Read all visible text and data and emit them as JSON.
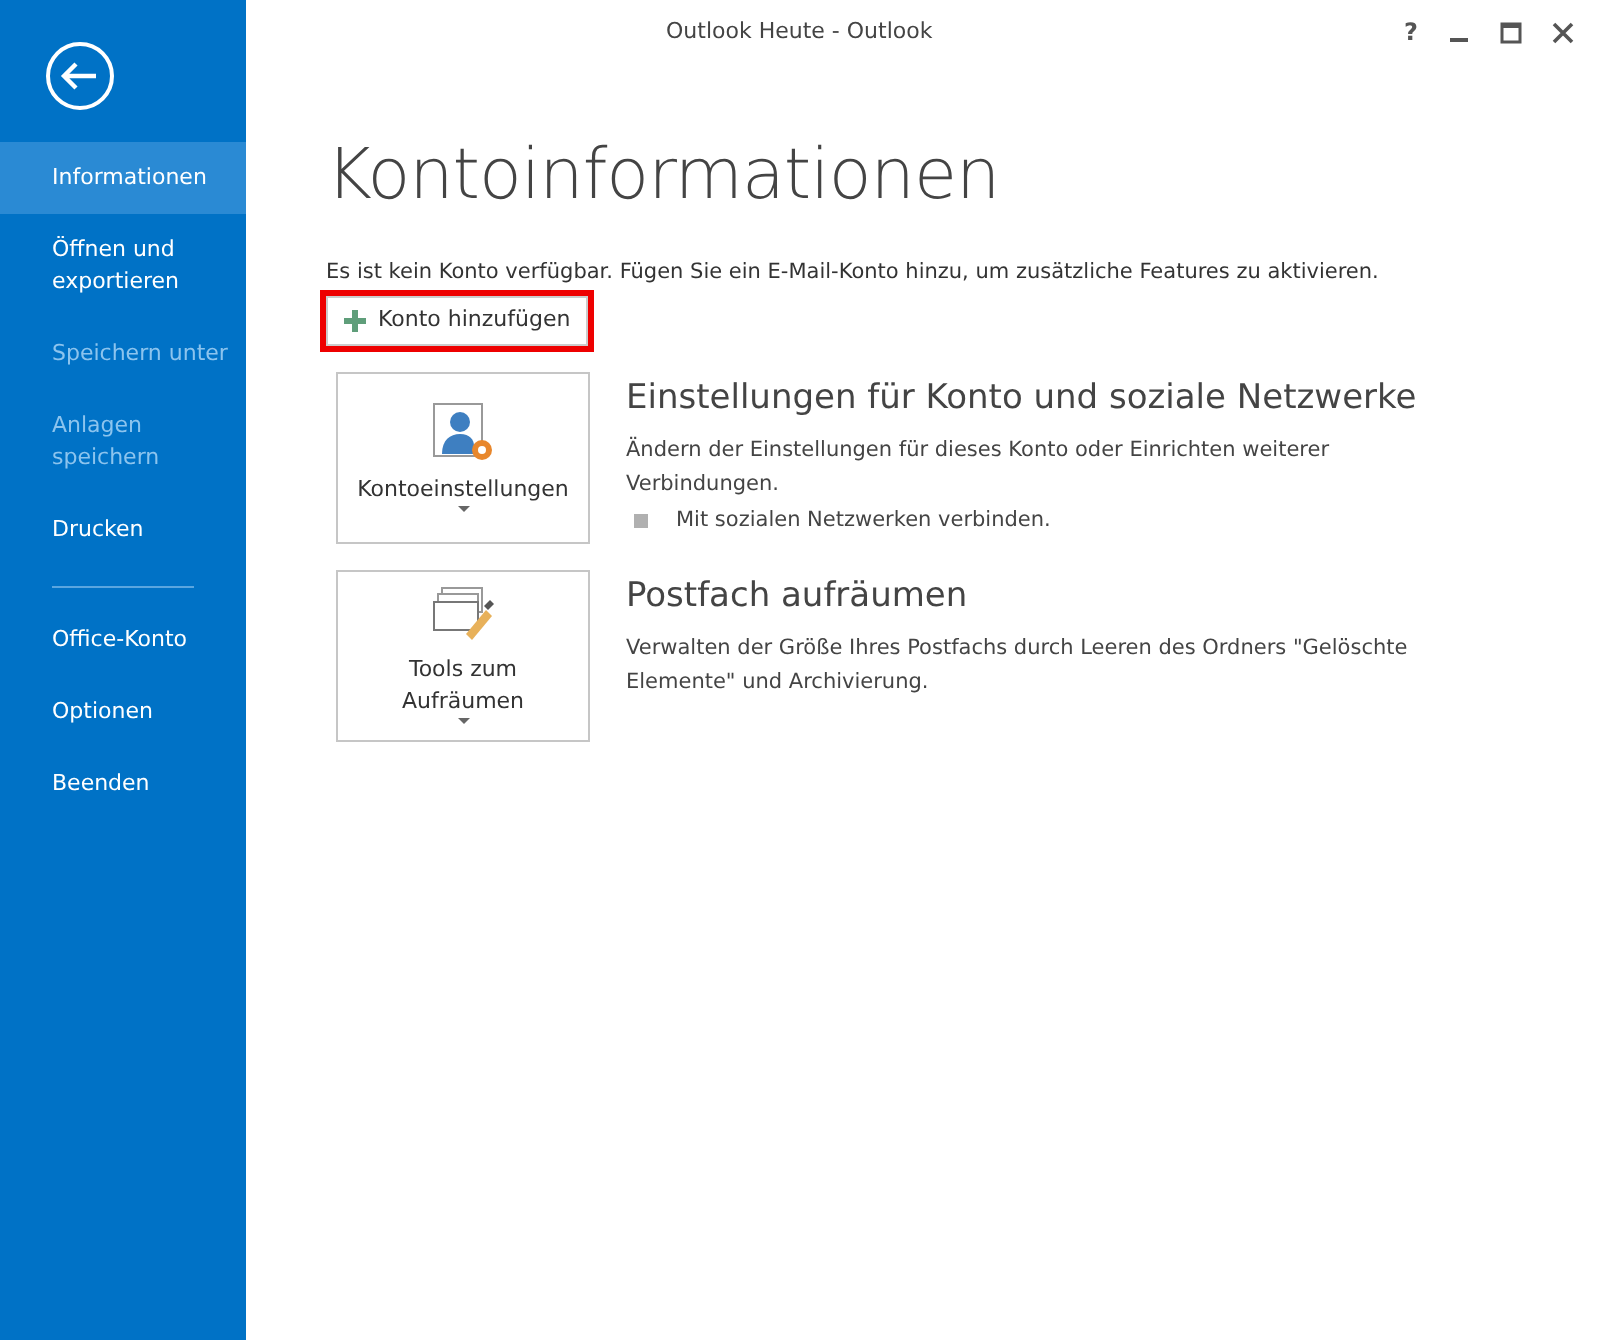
{
  "window": {
    "title": "Outlook Heute - Outlook",
    "help": "?"
  },
  "sidebar": {
    "items": [
      {
        "label": "Informationen",
        "selected": true,
        "disabled": false,
        "divider_after": false
      },
      {
        "label": "Öffnen und exportieren",
        "selected": false,
        "disabled": false,
        "divider_after": false
      },
      {
        "label": "Speichern unter",
        "selected": false,
        "disabled": true,
        "divider_after": false
      },
      {
        "label": "Anlagen speichern",
        "selected": false,
        "disabled": true,
        "divider_after": false
      },
      {
        "label": "Drucken",
        "selected": false,
        "disabled": false,
        "divider_after": true
      },
      {
        "label": "Office-Konto",
        "selected": false,
        "disabled": false,
        "divider_after": false
      },
      {
        "label": "Optionen",
        "selected": false,
        "disabled": false,
        "divider_after": false
      },
      {
        "label": "Beenden",
        "selected": false,
        "disabled": false,
        "divider_after": false
      }
    ]
  },
  "main": {
    "heading": "Kontoinformationen",
    "message": "Es ist kein Konto verfügbar. Fügen Sie ein E-Mail-Konto hinzu, um zusätzliche Features zu aktivieren.",
    "add_button": {
      "label": "Konto hinzufügen",
      "highlighted": true
    },
    "sections": [
      {
        "kind": "account",
        "tile_label": "Kontoeinstellungen",
        "title": "Einstellungen für Konto und soziale Netzwerke",
        "description": "Ändern der Einstellungen für dieses Konto oder Einrichten weiterer Verbindungen.",
        "bullets": [
          "Mit sozialen Netzwerken verbinden."
        ]
      },
      {
        "kind": "cleanup",
        "tile_label": "Tools zum Aufräumen",
        "title": "Postfach aufräumen",
        "description": "Verwalten der Größe Ihres Postfachs durch Leeren des Ordners \"Gelöschte Elemente\" und Archivierung."
      }
    ]
  }
}
